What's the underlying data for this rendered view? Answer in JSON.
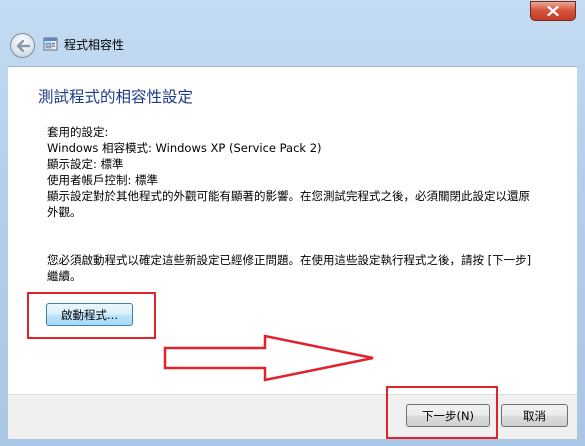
{
  "window": {
    "title": "程式相容性",
    "close_icon": "close-icon",
    "back_icon": "back-arrow-icon",
    "app_icon": "compatibility-wizard-icon",
    "accent_color": "#1e3a8a"
  },
  "main": {
    "heading": "測試程式的相容性設定",
    "applied_settings_label": "套用的設定:",
    "setting_mode": "Windows 相容模式: Windows XP (Service Pack 2)",
    "setting_display": "顯示設定: 標準",
    "setting_uac": "使用者帳戶控制: 標準",
    "note_line1": "顯示設定對於其他程式的外觀可能有顯著的影響。在您測試完程式之後，必須關閉此設定以還原",
    "note_line2": "外觀。",
    "instruction_line1": "您必須啟動程式以確定這些新設定已經修正問題。在使用這些設定執行程式之後，請按 [下一步]",
    "instruction_line2": "繼續。",
    "launch_button": "啟動程式..."
  },
  "footer": {
    "next_button": "下一步(N)",
    "cancel_button": "取消"
  },
  "annotations": {
    "highlight_color": "#e0222c"
  }
}
